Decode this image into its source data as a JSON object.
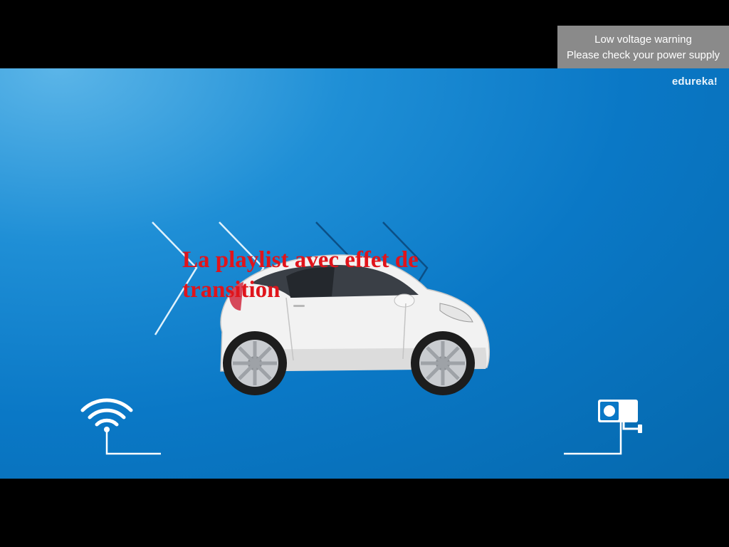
{
  "notification": {
    "line1": "Low voltage warning",
    "line2": "Please check your power supply"
  },
  "video": {
    "brand": "edureka!",
    "overlay_title": "La playlist avec effet de transition",
    "icons": [
      "wifi-icon",
      "camera-icon",
      "car-illustration",
      "chevron-arrows"
    ],
    "colors": {
      "background": "#000000",
      "slide_blue": "#0a78c6",
      "title_red": "#e0141b",
      "notification_gray": "#8a8a8a"
    }
  }
}
